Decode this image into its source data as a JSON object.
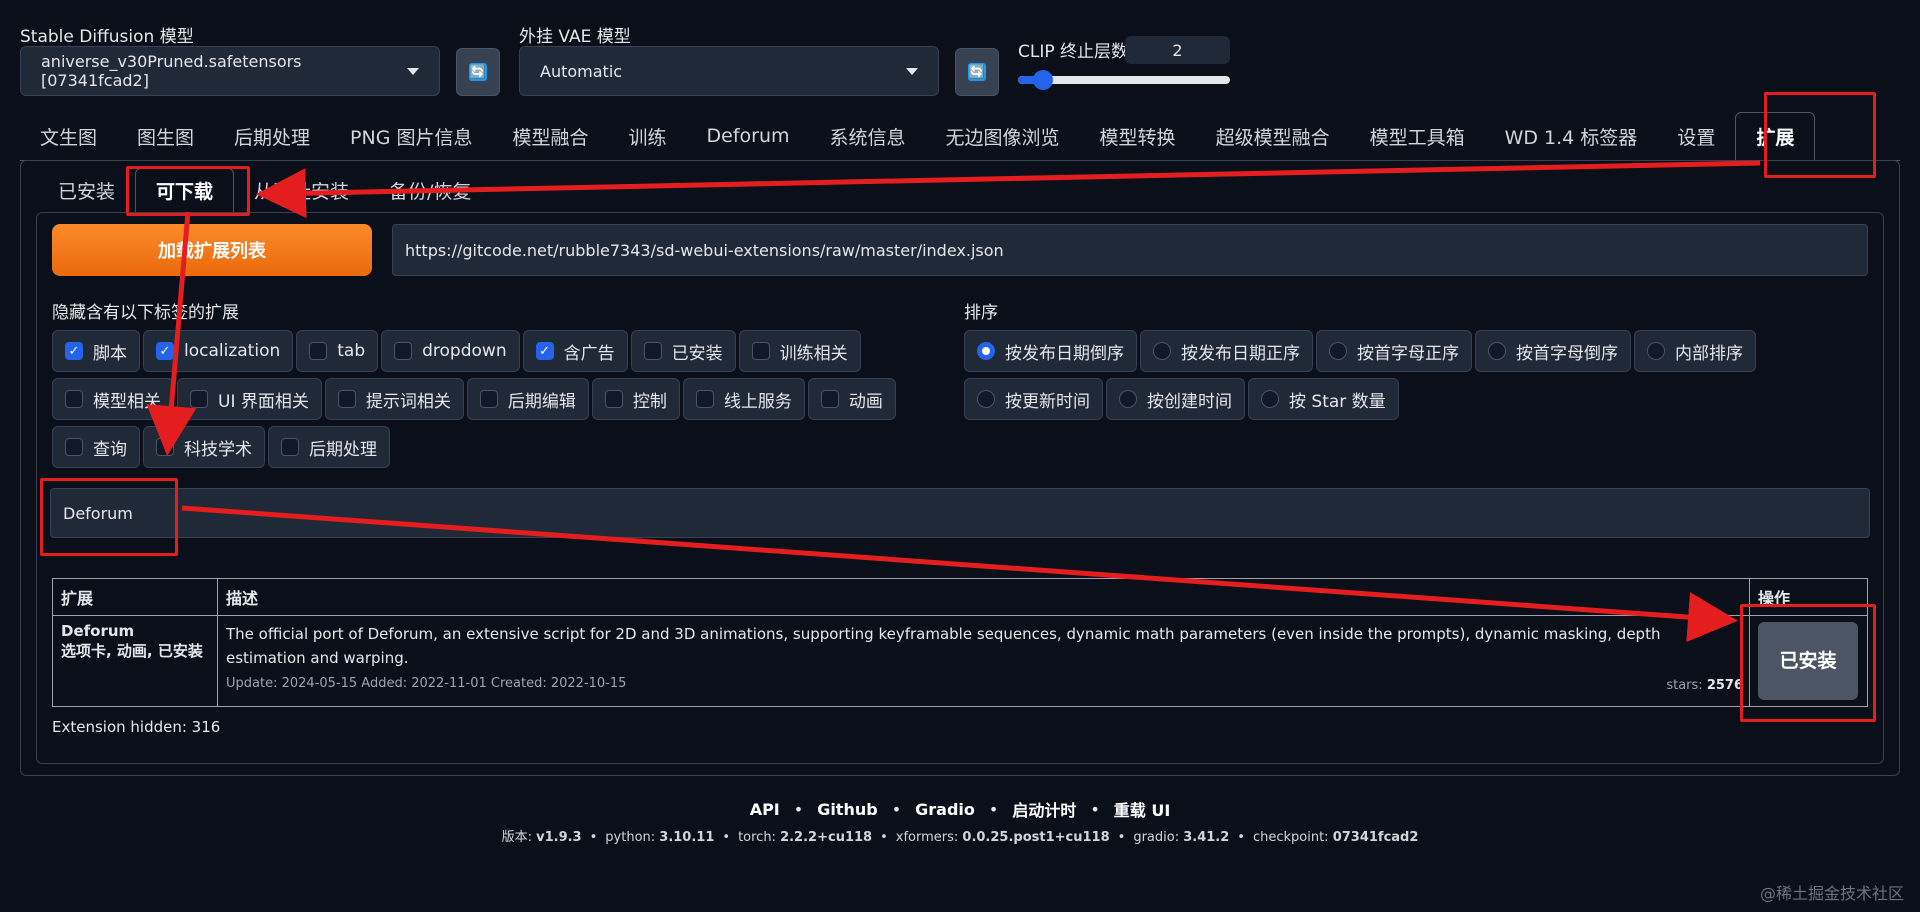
{
  "header": {
    "sd_model_label": "Stable Diffusion 模型",
    "sd_model_value": "aniverse_v30Pruned.safetensors [07341fcad2]",
    "vae_label": "外挂 VAE 模型",
    "vae_value": "Automatic",
    "refresh_glyph": "🔄",
    "clip_label": "CLIP 终止层数",
    "clip_value": "2",
    "clip_slider_fraction": 0.1
  },
  "tabs": [
    "文生图",
    "图生图",
    "后期处理",
    "PNG 图片信息",
    "模型融合",
    "训练",
    "Deforum",
    "系统信息",
    "无边图像浏览",
    "模型转换",
    "超级模型融合",
    "模型工具箱",
    "WD 1.4 标签器",
    "设置",
    "扩展"
  ],
  "subtabs": [
    "已安装",
    "可下载",
    "从网址安装",
    "备份/恢复"
  ],
  "load": {
    "button": "加载扩展列表",
    "url": "https://gitcode.net/rubble7343/sd-webui-extensions/raw/master/index.json"
  },
  "filters": {
    "title": "隐藏含有以下标签的扩展",
    "rows": [
      [
        {
          "label": "脚本",
          "checked": true
        },
        {
          "label": "localization",
          "checked": true
        },
        {
          "label": "tab",
          "checked": false
        },
        {
          "label": "dropdown",
          "checked": false
        },
        {
          "label": "含广告",
          "checked": true
        },
        {
          "label": "已安装",
          "checked": false
        },
        {
          "label": "训练相关",
          "checked": false
        }
      ],
      [
        {
          "label": "模型相关",
          "checked": false
        },
        {
          "label": "UI 界面相关",
          "checked": false
        },
        {
          "label": "提示词相关",
          "checked": false
        },
        {
          "label": "后期编辑",
          "checked": false
        },
        {
          "label": "控制",
          "checked": false
        },
        {
          "label": "线上服务",
          "checked": false
        },
        {
          "label": "动画",
          "checked": false
        }
      ],
      [
        {
          "label": "查询",
          "checked": false
        },
        {
          "label": "科技学术",
          "checked": false
        },
        {
          "label": "后期处理",
          "checked": false
        }
      ]
    ]
  },
  "sort": {
    "title": "排序",
    "rows": [
      [
        {
          "label": "按发布日期倒序",
          "selected": true
        },
        {
          "label": "按发布日期正序",
          "selected": false
        },
        {
          "label": "按首字母正序",
          "selected": false
        },
        {
          "label": "按首字母倒序",
          "selected": false
        },
        {
          "label": "内部排序",
          "selected": false
        }
      ],
      [
        {
          "label": "按更新时间",
          "selected": false
        },
        {
          "label": "按创建时间",
          "selected": false
        },
        {
          "label": "按 Star 数量",
          "selected": false
        }
      ]
    ]
  },
  "search": {
    "value": "Deforum"
  },
  "table": {
    "headers": [
      "扩展",
      "描述",
      "操作"
    ],
    "row": {
      "name": "Deforum",
      "tags": "选项卡, 动画, 已安装",
      "description": "The official port of Deforum, an extensive script for 2D and 3D animations, supporting keyframable sequences, dynamic math parameters (even inside the prompts), dynamic masking, depth estimation and warping.",
      "dates": "Update: 2024-05-15 Added: 2022-11-01 Created: 2022-10-15",
      "stars_label": "stars:",
      "stars_value": "2576",
      "action": "已安装"
    }
  },
  "hidden_count": "Extension hidden: 316",
  "footer": {
    "links": [
      "API",
      "Github",
      "Gradio",
      "启动计时",
      "重载 UI"
    ],
    "sep": "•",
    "version_parts": [
      {
        "k": "版本: ",
        "v": "v1.9.3"
      },
      {
        "k": "python: ",
        "v": "3.10.11"
      },
      {
        "k": "torch: ",
        "v": "2.2.2+cu118"
      },
      {
        "k": "xformers: ",
        "v": "0.0.25.post1+cu118"
      },
      {
        "k": "gradio: ",
        "v": "3.41.2"
      },
      {
        "k": "checkpoint: ",
        "v": "07341fcad2"
      }
    ]
  },
  "watermark": "@稀土掘金技术社区",
  "colors": {
    "accent": "#2563eb",
    "load_button": "#f97316",
    "annotation": "#e41e1e"
  }
}
